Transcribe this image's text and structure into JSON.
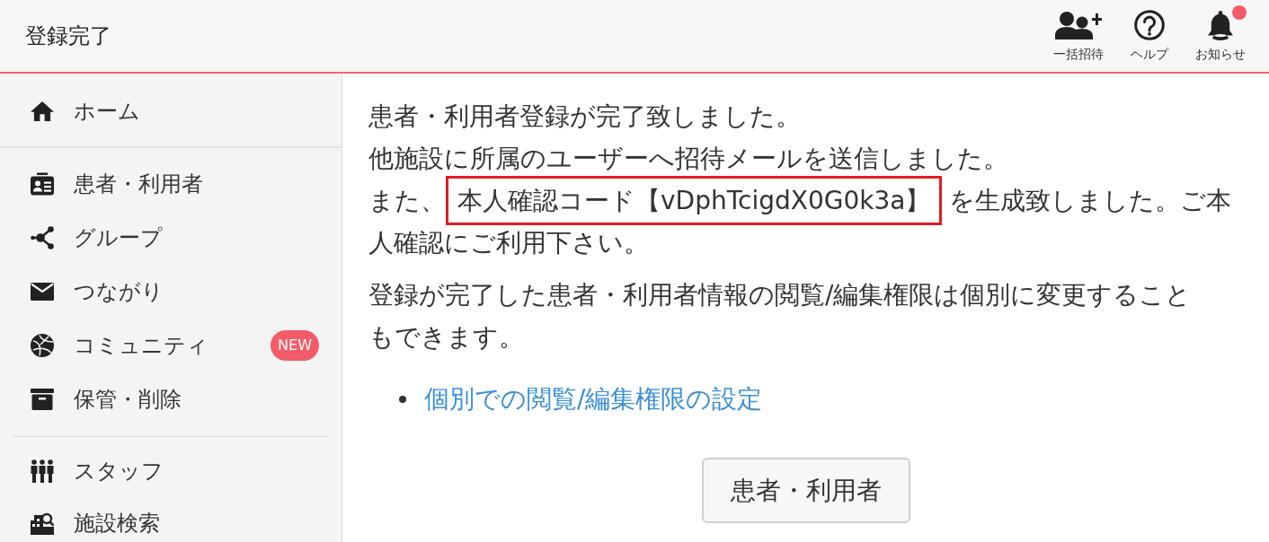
{
  "header": {
    "title": "登録完了",
    "actions": [
      {
        "kind": "invite",
        "label": "一括招待",
        "dot": false
      },
      {
        "kind": "help",
        "label": "ヘルプ",
        "dot": false
      },
      {
        "kind": "notifications",
        "label": "お知らせ",
        "dot": true
      }
    ]
  },
  "sidebar": {
    "sections": [
      {
        "items": [
          {
            "kind": "home",
            "label": "ホーム",
            "selected": false
          }
        ]
      },
      {
        "items": [
          {
            "kind": "patients",
            "label": "患者・利用者",
            "selected": false
          },
          {
            "kind": "groups",
            "label": "グループ",
            "selected": false
          },
          {
            "kind": "connections",
            "label": "つながり",
            "selected": false
          },
          {
            "kind": "community",
            "label": "コミュニティ",
            "selected": false,
            "badge": "NEW"
          },
          {
            "kind": "archive",
            "label": "保管・削除",
            "selected": false
          }
        ]
      },
      {
        "items": [
          {
            "kind": "staff",
            "label": "スタッフ",
            "selected": false
          },
          {
            "kind": "facility_search",
            "label": "施設検索",
            "selected": false
          }
        ]
      }
    ]
  },
  "main": {
    "message": [
      {
        "segments": [
          {
            "kind": "text",
            "text": "患者・利用者登録が完了致しました。"
          }
        ]
      },
      {
        "segments": [
          {
            "kind": "text",
            "text": "他施設に所属のユーザーへ招待メールを送信しました。"
          }
        ]
      },
      {
        "segments": [
          {
            "kind": "text",
            "text": "また、"
          },
          {
            "kind": "code",
            "text": "本人確認コード【vDphTcigdX0G0k3a】"
          },
          {
            "kind": "text",
            "text": "を生成致しました。ご本"
          }
        ]
      },
      {
        "segments": [
          {
            "kind": "text",
            "text": "人確認にご利用下さい。"
          }
        ]
      }
    ],
    "note": [
      "登録が完了した患者・利用者情報の閲覧/編集権限は個別に変更すること",
      "もできます。"
    ],
    "links": [
      "個別での閲覧/編集権限の設定"
    ],
    "button": "患者・利用者"
  }
}
